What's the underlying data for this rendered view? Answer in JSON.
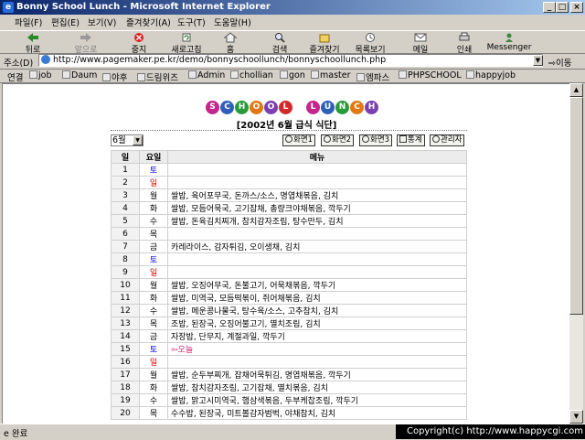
{
  "window": {
    "title": "Bonny School Lunch - Microsoft Internet Explorer",
    "icon": "ie-icon"
  },
  "menubar": [
    "파일(F)",
    "편집(E)",
    "보기(V)",
    "즐겨찾기(A)",
    "도구(T)",
    "도움말(H)"
  ],
  "toolbar": {
    "back": "뒤로",
    "forward": "앞으로",
    "stop": "중지",
    "refresh": "새로고침",
    "home": "홈",
    "search": "검색",
    "favorites": "즐겨찾기",
    "history": "목록보기",
    "mail": "메일",
    "print": "인쇄",
    "messenger": "Messenger"
  },
  "address": {
    "label": "주소(D)",
    "url": "http://www.pagemaker.pe.kr/demo/bonnyschoollunch/bonnyschoollunch.php",
    "go": "이동"
  },
  "links": {
    "label": "연결",
    "items": [
      "job",
      "Daum",
      "야후",
      "드림위즈",
      "Admin",
      "chollian",
      "gon",
      "master",
      "엠파스",
      "PHPSCHOOL",
      "happyjob"
    ]
  },
  "page": {
    "logo_letters": [
      "S",
      "C",
      "H",
      "O",
      "O",
      "L",
      "",
      "L",
      "U",
      "N",
      "C",
      "H"
    ],
    "logo_colors": [
      "#c4268c",
      "#2f5fb8",
      "#2a9a3a",
      "#e07a10",
      "#7b3fb0",
      "#d02a2a",
      "",
      "#c4268c",
      "#2f5fb8",
      "#2a9a3a",
      "#e07a10",
      "#7b3fb0"
    ],
    "subtitle": "[2002년 6월 급식 식단]",
    "month_select": "6월",
    "buttons": [
      "화면1",
      "화면2",
      "화면3",
      "통계",
      "관리자"
    ],
    "headers": {
      "day": "일",
      "weekday": "요일",
      "menu": "메뉴"
    },
    "today_label": "오늘",
    "rows": [
      {
        "day": "1",
        "weekday": "토",
        "menu": ""
      },
      {
        "day": "2",
        "weekday": "일",
        "menu": ""
      },
      {
        "day": "3",
        "weekday": "월",
        "menu": "쌀밥, 육어포무국, 돈까스/소스, 명엽채볶음, 김치"
      },
      {
        "day": "4",
        "weekday": "화",
        "menu": "쌀밥, 모듬어묵국, 고기잡채, 총량크야채볶음, 깍두기"
      },
      {
        "day": "5",
        "weekday": "수",
        "menu": "쌀밥, 돈육김치찌개, 참치감자조림, 탕수만두, 김치"
      },
      {
        "day": "6",
        "weekday": "목",
        "menu": ""
      },
      {
        "day": "7",
        "weekday": "금",
        "menu": "카레라이스, 감자튀김, 오이생채, 김치"
      },
      {
        "day": "8",
        "weekday": "토",
        "menu": ""
      },
      {
        "day": "9",
        "weekday": "일",
        "menu": ""
      },
      {
        "day": "10",
        "weekday": "월",
        "menu": "쌀밥, 오징어무국, 돈불고기, 어묵채볶음, 깍두기"
      },
      {
        "day": "11",
        "weekday": "화",
        "menu": "쌀밥, 미역국, 모듬떡볶이, 쥐어채볶음, 김치"
      },
      {
        "day": "12",
        "weekday": "수",
        "menu": "쌀밥, 메운콩나물국, 탕수육/소스, 고추참치, 김치"
      },
      {
        "day": "13",
        "weekday": "목",
        "menu": "조밥, 된장국, 오징어불고기, 멸치조림, 김치"
      },
      {
        "day": "14",
        "weekday": "금",
        "menu": "자장밥, 단무지, 계절과일, 깍두기"
      },
      {
        "day": "15",
        "weekday": "토",
        "menu": "",
        "today": true
      },
      {
        "day": "16",
        "weekday": "일",
        "menu": ""
      },
      {
        "day": "17",
        "weekday": "월",
        "menu": "쌀밥, 순두부찌개, 잡채어묵튀김, 명엽채볶음, 깍두기"
      },
      {
        "day": "18",
        "weekday": "화",
        "menu": "쌀밥, 참치감자조림, 고기잡채, 멸치볶음, 김치"
      },
      {
        "day": "19",
        "weekday": "수",
        "menu": "쌀밥, 맑고시미역국, 햄삼색볶음, 두부케찹조림, 깍두기"
      },
      {
        "day": "20",
        "weekday": "목",
        "menu": "수수밥, 된장국, 미트볼감자범벅, 야채참치, 김치"
      }
    ]
  },
  "status": {
    "text": "완료",
    "copyright": "Copyright(c) http://www.happycgi.com"
  }
}
